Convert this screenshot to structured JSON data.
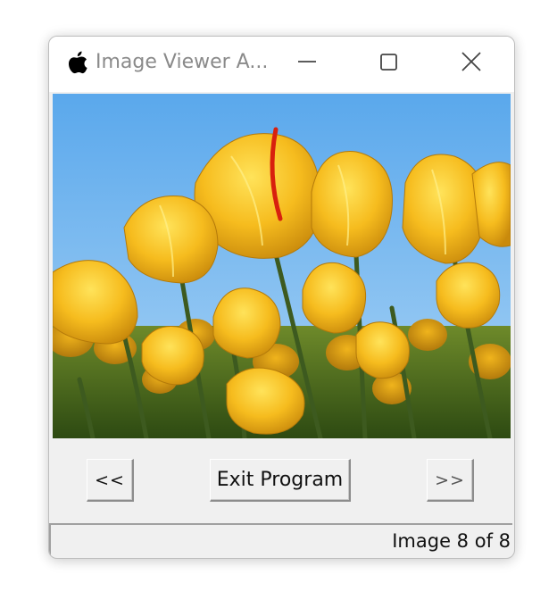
{
  "window": {
    "title": "Image Viewer A...",
    "app_icon": "apple-icon",
    "controls": [
      "minimize-icon",
      "maximize-icon",
      "close-icon"
    ]
  },
  "viewer": {
    "image_subject": "yellow-tulips-photo"
  },
  "buttons": {
    "prev_label": "<<",
    "exit_label": "Exit Program",
    "next_label": ">>"
  },
  "status": {
    "text": "Image 8 of 8"
  },
  "colors": {
    "window_bg": "#f0f0f0",
    "titlebar_bg": "#ffffff",
    "title_text": "#8a8a8a",
    "sky": "#6fb6ef",
    "tulip": "#f4b81c",
    "stem": "#3d5a1f"
  }
}
